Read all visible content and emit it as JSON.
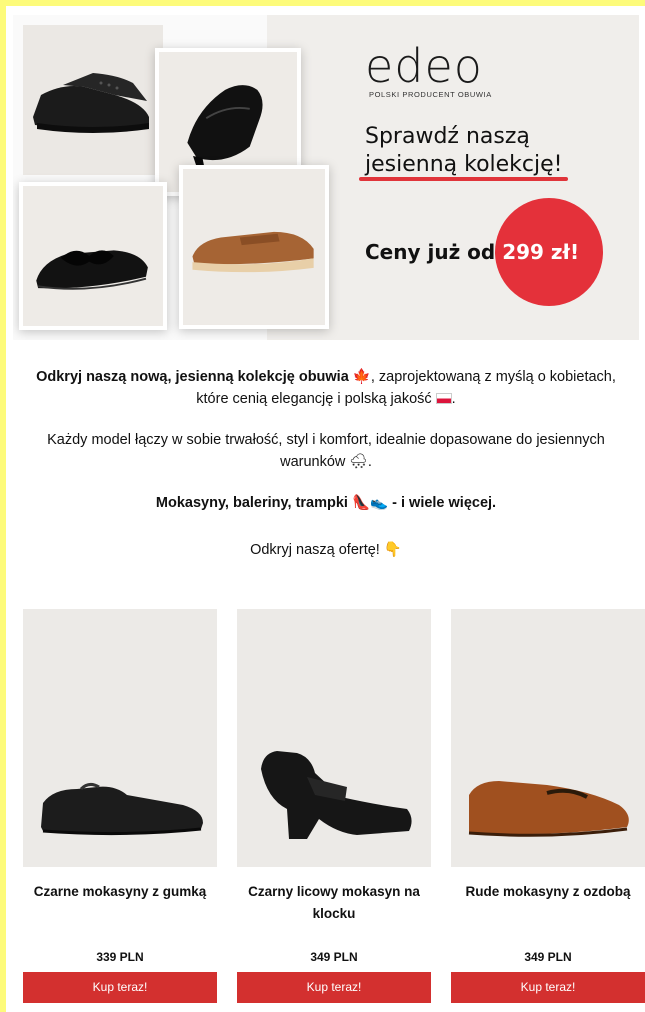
{
  "hero": {
    "logo": "edeo",
    "logo_tagline": "POLSKI PRODUCENT OBUWIA",
    "headline_line1": "Sprawdź naszą",
    "headline_line2": "jesienną kolekcję!",
    "price_prefix": "Ceny już od",
    "price_value": "299 zł!"
  },
  "intro": {
    "p1_bold": "Odkryj naszą nową, jesienną kolekcję obuwia",
    "p1_leaf_icon": "🍁",
    "p1_rest": ", zaprojektowaną z myślą o kobietach, które cenią elegancję i polską jakość",
    "p1_flag_icon": "polish-flag",
    "p1_end": ".",
    "p2_text": "Każdy model łączy w sobie trwałość, styl i komfort, idealnie dopasowane do jesiennych warunków",
    "p2_icon": "🌨",
    "p2_end": ".",
    "p3_bold_start": "Mokasyny, baleriny, trampki",
    "p3_icons": "👠👟",
    "p3_bold_end": " - i wiele więcej.",
    "p4_text": "Odkryj naszą ofertę!",
    "p4_icon": "👇"
  },
  "products": [
    {
      "name": "Czarne mokasyny z gumką",
      "price": "339 PLN",
      "button": "Kup teraz!",
      "shoe_color": "#1c1c1c"
    },
    {
      "name": "Czarny licowy mokasyn na klocku",
      "price": "349 PLN",
      "button": "Kup teraz!",
      "shoe_color": "#1a1a1a"
    },
    {
      "name": "Rude mokasyny z ozdobą",
      "price": "349 PLN",
      "button": "Kup teraz!",
      "shoe_color": "#a0501f"
    }
  ],
  "colors": {
    "accent_red": "#d3302f",
    "page_border": "#fdfb7a",
    "hero_bg": "#f0eeeb"
  }
}
